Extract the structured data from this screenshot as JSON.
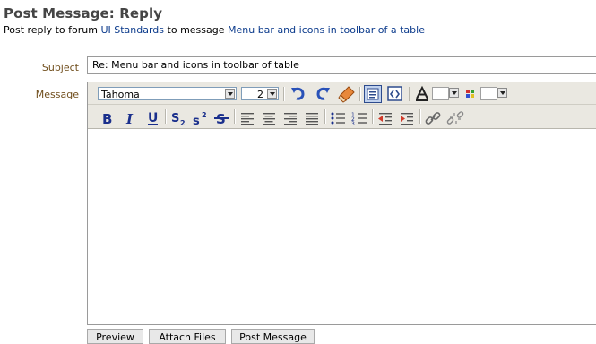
{
  "page": {
    "title": "Post Message: Reply",
    "subtitle_prefix": "Post reply to forum ",
    "forum_link": "UI Standards",
    "subtitle_middle": " to message ",
    "message_link": "Menu bar and icons in toolbar of a table"
  },
  "form": {
    "subject_label": "Subject",
    "subject_value": "Re: Menu bar and icons in toolbar of table",
    "message_label": "Message"
  },
  "toolbar": {
    "font_value": "Tahoma",
    "size_value": "2",
    "icons_row1": [
      "undo-icon",
      "redo-icon",
      "eraser-icon",
      "design-view-icon",
      "source-view-icon",
      "text-color-icon",
      "background-color-icon"
    ],
    "icons_row2": [
      "bold-icon",
      "italic-icon",
      "underline-icon",
      "subscript-icon",
      "superscript-icon",
      "strikethrough-icon",
      "align-left-icon",
      "align-center-icon",
      "align-right-icon",
      "justify-icon",
      "bullet-list-icon",
      "numbered-list-icon",
      "outdent-icon",
      "indent-icon",
      "link-icon",
      "unlink-icon"
    ],
    "accent_color": "#1a2f8c"
  },
  "buttons": {
    "preview": "Preview",
    "attach": "Attach Files",
    "post": "Post Message"
  }
}
